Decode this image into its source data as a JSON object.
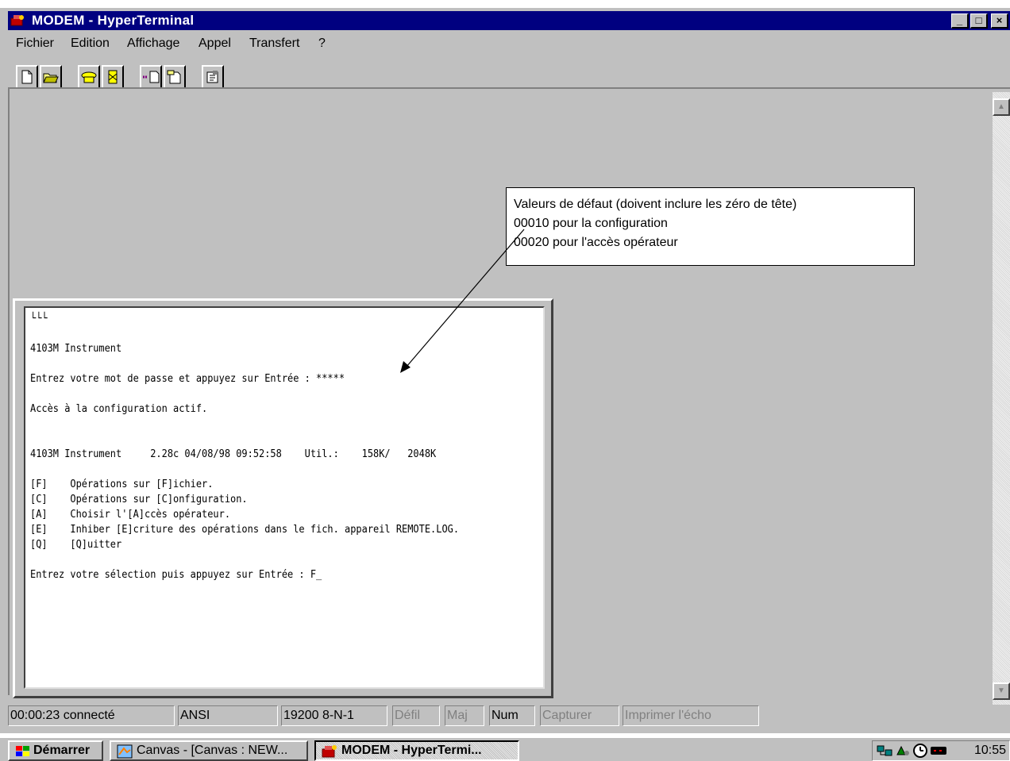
{
  "window": {
    "title": "MODEM - HyperTerminal",
    "controls": {
      "minimize": "_",
      "maximize": "□",
      "close": "×"
    }
  },
  "menu": [
    {
      "label": "Fichier"
    },
    {
      "label": "Edition"
    },
    {
      "label": "Affichage"
    },
    {
      "label": "Appel"
    },
    {
      "label": "Transfert"
    },
    {
      "label": "?"
    }
  ],
  "toolbar": {
    "icons": [
      "new-icon",
      "open-icon",
      "connect-phone-icon",
      "disconnect-icon",
      "send-icon",
      "receive-icon",
      "properties-icon"
    ]
  },
  "terminal": {
    "lines": [
      "└└└",
      "",
      "4103M Instrument",
      "",
      "Entrez votre mot de passe et appuyez sur Entrée : *****",
      "",
      "Accès à la configuration actif.",
      "",
      "",
      "4103M Instrument     2.28c 04/08/98 09:52:58    Util.:    158K/   2048K",
      "",
      "[F]    Opérations sur [F]ichier.",
      "[C]    Opérations sur [C]onfiguration.",
      "[A]    Choisir l'[A]ccès opérateur.",
      "[E]    Inhiber [E]criture des opérations dans le fich. appareil REMOTE.LOG.",
      "[Q]    [Q]uitter",
      "",
      "Entrez votre sélection puis appuyez sur Entrée : F_"
    ]
  },
  "callout": {
    "line1": "Valeurs de défaut (doivent inclure les zéro de tête)",
    "line2": "00010 pour la configuration",
    "line3": "00020 pour l'accès opérateur"
  },
  "status": {
    "connected": "00:00:23 connecté",
    "emulation": "ANSI",
    "settings": "19200 8-N-1",
    "scroll": "Défil",
    "caps": "Maj",
    "num": "Num",
    "capture": "Capturer",
    "print_echo": "Imprimer l'écho"
  },
  "taskbar": {
    "start": "Démarrer",
    "tasks": [
      {
        "label": "Canvas - [Canvas : NEW...",
        "active": false
      },
      {
        "label": "MODEM - HyperTermi...",
        "active": true
      }
    ],
    "clock": "10:55"
  },
  "colors": {
    "titlebar": "#000080",
    "face": "#c0c0c0",
    "window_bg": "#ffffff"
  }
}
